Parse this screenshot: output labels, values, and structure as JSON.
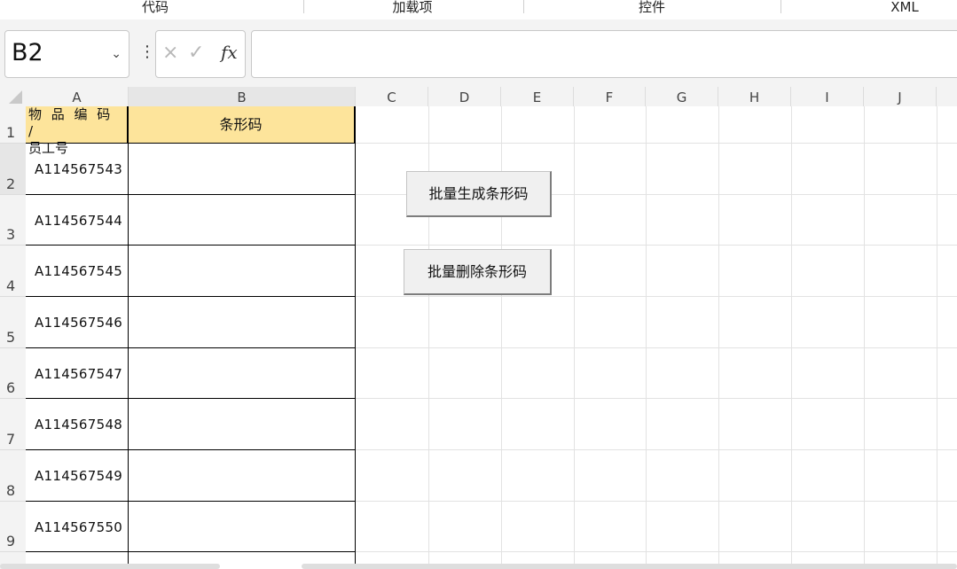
{
  "ribbon": {
    "groups": [
      "代码",
      "加载项",
      "控件",
      "XML"
    ]
  },
  "formula_bar": {
    "name_box": "B2",
    "cancel_symbol": "×",
    "enter_symbol": "✓",
    "fx_symbol": "fx",
    "formula": ""
  },
  "columns": [
    "A",
    "B",
    "C",
    "D",
    "E",
    "F",
    "G",
    "H",
    "I",
    "J"
  ],
  "rows": [
    "1",
    "2",
    "3",
    "4",
    "5",
    "6",
    "7",
    "8",
    "9"
  ],
  "table": {
    "header_a_line1": "物 品 编 码 /",
    "header_a_line2": "员工号",
    "header_b": "条形码",
    "header_color": "#fde49b",
    "items": [
      "A114567543",
      "A114567544",
      "A114567545",
      "A114567546",
      "A114567547",
      "A114567548",
      "A114567549",
      "A114567550"
    ]
  },
  "buttons": {
    "generate": "批量生成条形码",
    "delete": "批量删除条形码"
  }
}
